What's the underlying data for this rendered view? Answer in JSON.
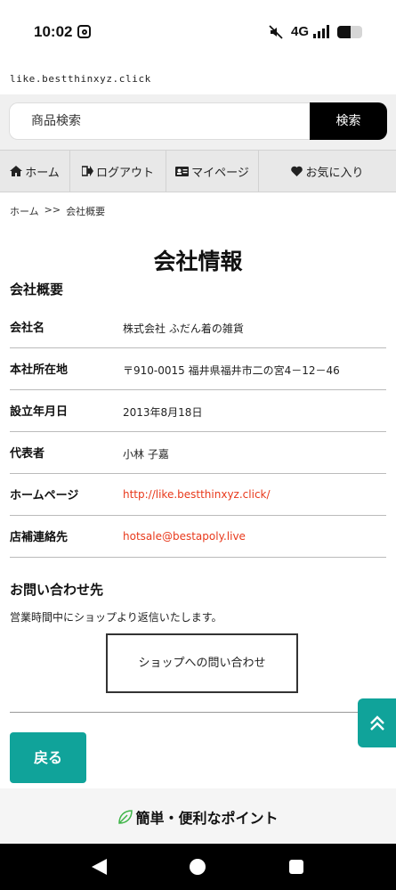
{
  "status_bar": {
    "time": "10:02",
    "network": "4G",
    "battery_level": 0.55,
    "icons": [
      "instagram-icon",
      "mute-icon",
      "signal-icon",
      "battery-icon"
    ]
  },
  "browser": {
    "url": "like.bestthinxyz.click"
  },
  "search": {
    "placeholder": "商品検索",
    "button_label": "検索"
  },
  "nav": {
    "items": [
      {
        "label": "ホーム",
        "icon": "home-icon"
      },
      {
        "label": "ログアウト",
        "icon": "logout-icon"
      },
      {
        "label": "マイページ",
        "icon": "id-card-icon"
      },
      {
        "label": "お気に入り",
        "icon": "heart-icon"
      }
    ]
  },
  "breadcrumb": {
    "home": "ホーム",
    "separator": ">>",
    "current": "会社概要"
  },
  "page": {
    "title": "会社情報",
    "overview_heading": "会社概要",
    "company_info": [
      {
        "label": "会社名",
        "value": "株式会社 ふだん着の雑貨"
      },
      {
        "label": "本社所在地",
        "value": "〒910-0015 福井県福井市二の宮4－12－46"
      },
      {
        "label": "設立年月日",
        "value": "2013年8月18日"
      },
      {
        "label": "代表者",
        "value": "小林 子嘉"
      },
      {
        "label": "ホームページ",
        "value": "http://like.bestthinxyz.click/"
      },
      {
        "label": "店補連絡先",
        "value": "hotsale@bestapoly.live"
      }
    ],
    "contact_heading": "お問い合わせ先",
    "contact_note": "営業時間中にショップより返信いたします。",
    "contact_button": "ショップへの問い合わせ",
    "back_button": "戻る"
  },
  "footer": {
    "title": "簡単・便利なポイント"
  },
  "colors": {
    "accent": "#10a39a",
    "link": "#e8391b",
    "dark": "#000000"
  }
}
